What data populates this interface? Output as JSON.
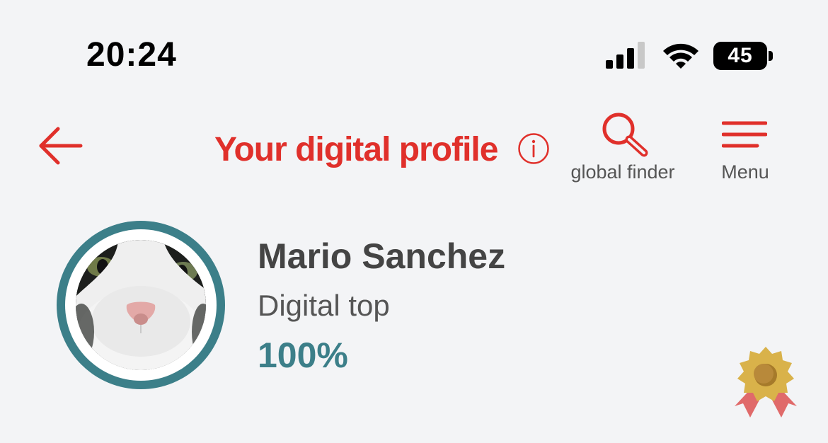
{
  "status_bar": {
    "time": "20:24",
    "battery": "45",
    "icons": [
      "signal-icon",
      "wifi-icon",
      "battery-icon"
    ]
  },
  "header": {
    "back_icon": "arrow-left-icon",
    "title": "Your digital profile",
    "info_icon": "info-icon",
    "finder_label": "global finder",
    "finder_icon": "search-icon",
    "menu_label": "Menu",
    "menu_icon": "hamburger-icon"
  },
  "profile": {
    "name": "Mario Sanchez",
    "level": "Digital top",
    "progress": "100%",
    "avatar": "cat-photo",
    "badge_icon": "award-badge-icon"
  },
  "colors": {
    "brand_red": "#e0302b",
    "teal": "#3c7f89",
    "background": "#f3f4f6",
    "badge_gold": "#d9b24a",
    "badge_ribbon": "#e06a6a"
  }
}
